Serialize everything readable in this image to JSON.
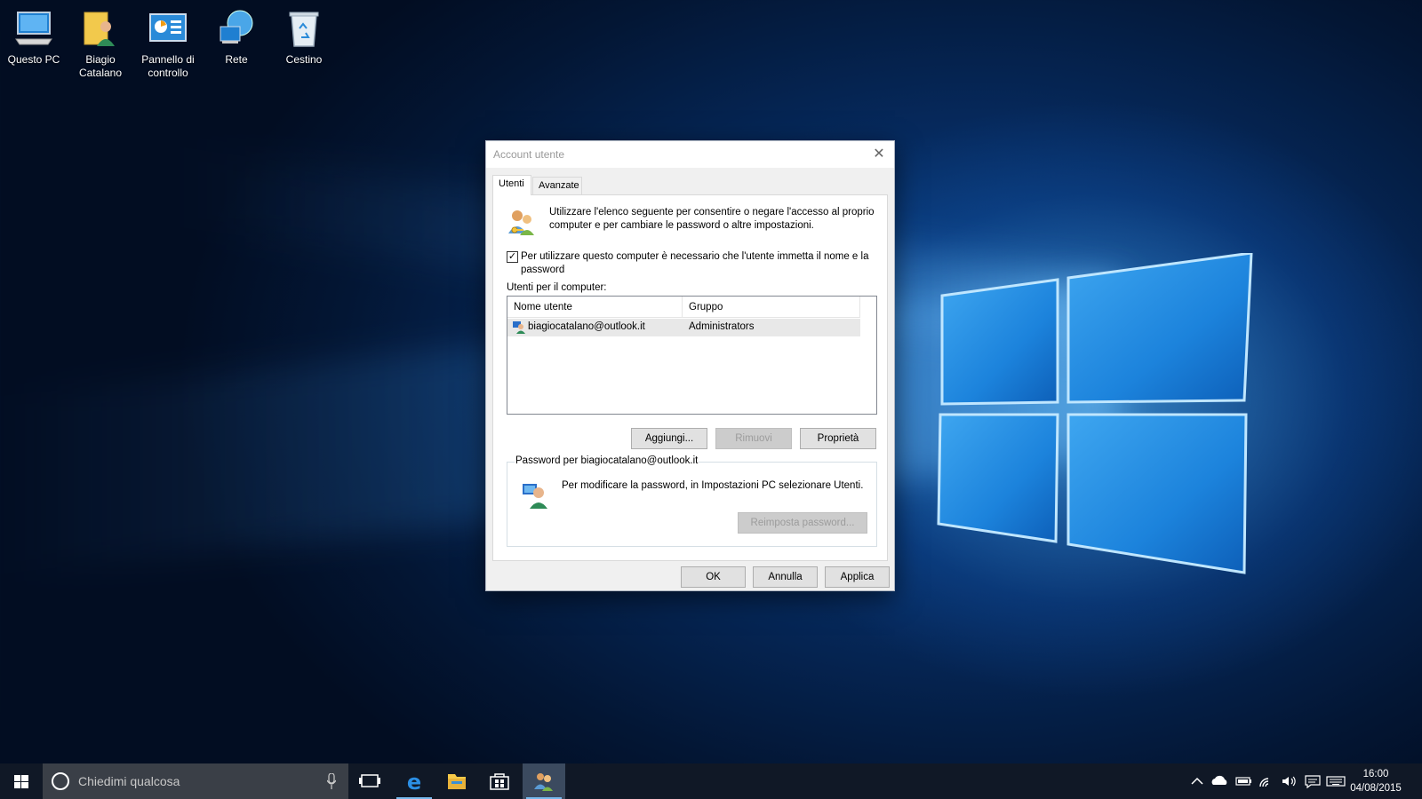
{
  "desktop": {
    "icons": [
      {
        "label": "Questo PC",
        "icon": "computer-icon"
      },
      {
        "label": "Biagio Catalano",
        "icon": "user-folder-icon"
      },
      {
        "label": "Pannello di controllo",
        "icon": "control-panel-icon"
      },
      {
        "label": "Rete",
        "icon": "network-icon"
      },
      {
        "label": "Cestino",
        "icon": "recycle-bin-icon"
      }
    ]
  },
  "dialog": {
    "title": "Account utente",
    "close_glyph": "✕",
    "tabs": [
      "Utenti",
      "Avanzate"
    ],
    "active_tab": "Utenti",
    "intro": "Utilizzare l'elenco seguente per consentire o negare l'accesso al proprio computer e per cambiare le password o altre impostazioni.",
    "require_login": {
      "checked": true,
      "check_glyph": "✓",
      "label": "Per utilizzare questo computer è necessario che l'utente immetta il nome e la password"
    },
    "users_label": "Utenti per il computer:",
    "columns": [
      "Nome utente",
      "Gruppo"
    ],
    "rows": [
      {
        "name": "biagiocatalano@outlook.it",
        "group": "Administrators"
      }
    ],
    "buttons": {
      "add": "Aggiungi...",
      "remove": "Rimuovi",
      "properties": "Proprietà",
      "ok": "OK",
      "cancel": "Annulla",
      "apply": "Applica"
    },
    "password_group": {
      "title": "Password per biagiocatalano@outlook.it",
      "text": "Per modificare la password, in Impostazioni PC selezionare Utenti.",
      "reset_button": "Reimposta password..."
    }
  },
  "taskbar": {
    "search_placeholder": "Chiedimi qualcosa",
    "apps": [
      "task-view-icon",
      "edge-icon",
      "file-explorer-icon",
      "store-icon",
      "user-accounts-icon"
    ],
    "time": "16:00",
    "date": "04/08/2015"
  },
  "colors": {
    "accent": "#76b9ed",
    "taskbar": "#101826",
    "dialog_bg": "#f0f0f0"
  }
}
